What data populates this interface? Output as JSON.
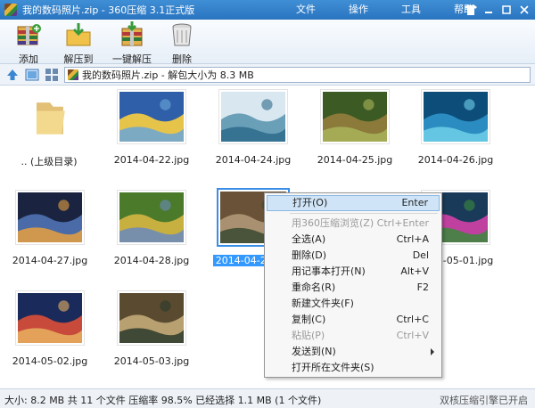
{
  "window": {
    "title": "我的数码照片.zip - 360压缩 3.1正式版"
  },
  "menu": [
    {
      "label": "文件"
    },
    {
      "label": "操作"
    },
    {
      "label": "工具"
    },
    {
      "label": "帮助"
    }
  ],
  "toolbar": {
    "add": "添加",
    "extract_to": "解压到",
    "one_click": "一键解压",
    "delete": "删除"
  },
  "address": {
    "path": "我的数码照片.zip - 解包大小为 8.3 MB"
  },
  "files": [
    {
      "name": ".. (上级目录)",
      "type": "folder"
    },
    {
      "name": "2014-04-22.jpg",
      "colors": [
        "#2f5fa8",
        "#e6c44a",
        "#6aa6d8"
      ]
    },
    {
      "name": "2014-04-24.jpg",
      "colors": [
        "#d9e7f0",
        "#6a9fb8",
        "#2d6a8a"
      ]
    },
    {
      "name": "2014-04-25.jpg",
      "colors": [
        "#3c5a24",
        "#8b7a3a",
        "#a9b45a"
      ]
    },
    {
      "name": "2014-04-26.jpg",
      "colors": [
        "#0d4d7a",
        "#2a8cc0",
        "#6fd0e8"
      ]
    },
    {
      "name": "2014-04-27.jpg",
      "colors": [
        "#1a2440",
        "#4a6aa8",
        "#e8a040"
      ]
    },
    {
      "name": "2014-04-28.jpg",
      "colors": [
        "#4a7a2a",
        "#c8b040",
        "#6a8ac0"
      ]
    },
    {
      "name": "2014-04-29.jpg",
      "colors": [
        "#6a5238",
        "#a89070",
        "#3a4a30"
      ]
    },
    {
      "name": "2014-05-01.jpg",
      "colors": [
        "#1a3a5a",
        "#c040a0",
        "#3a8a3a"
      ]
    },
    {
      "name": "2014-05-02.jpg",
      "colors": [
        "#1a2a5a",
        "#c84a3a",
        "#e8b060"
      ]
    },
    {
      "name": "2014-05-03.jpg",
      "colors": [
        "#5a4a30",
        "#b8a070",
        "#2a3a2a"
      ]
    }
  ],
  "context_menu": [
    {
      "label": "打开(O)",
      "shortcut": "Enter",
      "state": "highlight"
    },
    {
      "sep": true
    },
    {
      "label": "用360压缩浏览(Z)",
      "shortcut": "Ctrl+Enter",
      "state": "disabled"
    },
    {
      "label": "全选(A)",
      "shortcut": "Ctrl+A"
    },
    {
      "label": "删除(D)",
      "shortcut": "Del"
    },
    {
      "label": "用记事本打开(N)",
      "shortcut": "Alt+V"
    },
    {
      "label": "重命名(R)",
      "shortcut": "F2"
    },
    {
      "label": "新建文件夹(F)",
      "shortcut": ""
    },
    {
      "label": "复制(C)",
      "shortcut": "Ctrl+C"
    },
    {
      "label": "粘贴(P)",
      "shortcut": "Ctrl+V",
      "state": "disabled"
    },
    {
      "label": "发送到(N)",
      "shortcut": "",
      "submenu": true
    },
    {
      "label": "打开所在文件夹(S)",
      "shortcut": ""
    }
  ],
  "status": {
    "text": "大小: 8.2 MB 共 11 个文件 压缩率 98.5% 已经选择 1.1 MB (1 个文件)",
    "right": "双核压缩引擎已开启"
  }
}
